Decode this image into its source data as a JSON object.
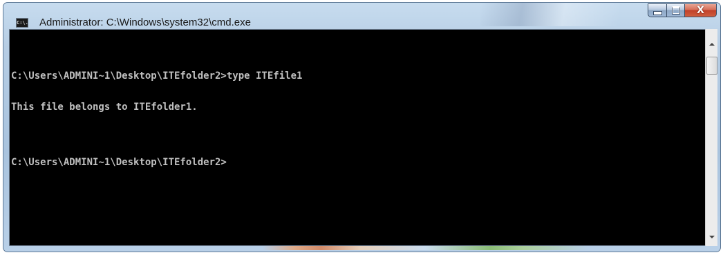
{
  "window": {
    "title": "Administrator: C:\\Windows\\system32\\cmd.exe",
    "icon": "cmd-icon",
    "icon_text": "C:\\.",
    "controls": {
      "minimize": "minimize-icon",
      "maximize": "maximize-icon",
      "close_label": "X"
    }
  },
  "console": {
    "lines": [
      "C:\\Users\\ADMINI~1\\Desktop\\ITEfolder2>type ITEfile1",
      "This file belongs to ITEfolder1.",
      "",
      "C:\\Users\\ADMINI~1\\Desktop\\ITEfolder2>"
    ],
    "background": "#000000",
    "foreground": "#c0c0c0"
  },
  "scrollbar": {
    "up_icon": "scroll-up-arrow-icon",
    "down_icon": "scroll-down-arrow-icon"
  }
}
